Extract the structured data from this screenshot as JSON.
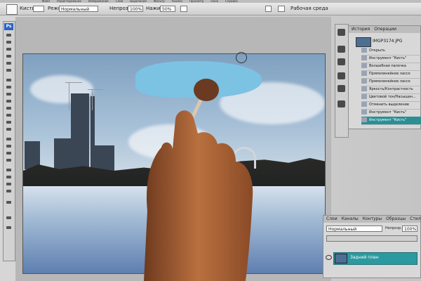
{
  "menu": [
    "Файл",
    "Редактирование",
    "Изображение",
    "Слой",
    "Выделение",
    "Фильтр",
    "Анализ",
    "Просмотр",
    "Окно",
    "Справка"
  ],
  "options": {
    "brush_label": "Кисть:",
    "mode_label": "Режим:",
    "mode_value": "Нормальный",
    "opacity_label": "Непрозр.:",
    "opacity_value": "100%",
    "flow_label": "Нажим:",
    "flow_value": "50%",
    "workspace_label": "Рабочая среда"
  },
  "toolbox": {
    "logo": "Ps"
  },
  "history": {
    "tabs": [
      "История",
      "Операции"
    ],
    "snapshot": "IMGP3174.JPG",
    "items": [
      "Открыть",
      "Инструмент \"Кисть\"",
      "Волшебная палочка",
      "Прямолинейное лассо",
      "Прямолинейное лассо",
      "Яркость/Контрастность",
      "Цветовой тон/Насыщен...",
      "Отменить выделение",
      "Инструмент \"Кисть\"",
      "Инструмент \"Кисть\""
    ]
  },
  "layers": {
    "tabs": [
      "Слои",
      "Каналы",
      "Контуры",
      "Образцы",
      "Стили"
    ],
    "mode": "Нормальный",
    "opacity_label": "Непрозр.:",
    "opacity_value": "100%",
    "layer_name": "Задний план"
  },
  "colors": {
    "accent": "#2b8f95",
    "paint": "#7cc2e3"
  }
}
